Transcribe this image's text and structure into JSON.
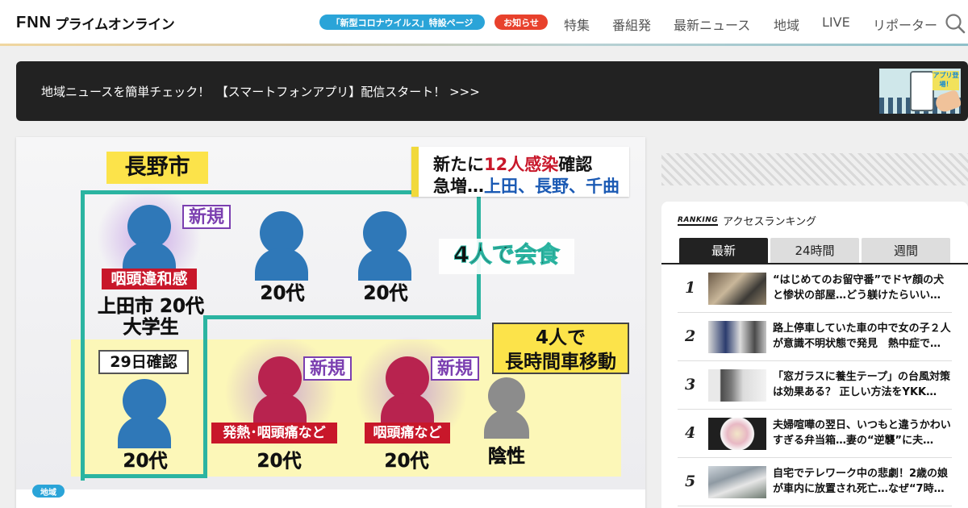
{
  "header": {
    "logo_fnn": "FNN",
    "logo_jp": "プライムオンライン",
    "covid_pill": "「新型コロナウイルス」特設ページ",
    "notice_pill": "お知らせ",
    "nav": [
      "特集",
      "番組発",
      "最新ニュース",
      "地域",
      "LIVE",
      "リポーター"
    ]
  },
  "banner": {
    "text": "地域ニュースを簡単チェック！　【スマートフォンアプリ】配信スタート！ >>>",
    "thumb_badge": "アプリ登場！"
  },
  "hero": {
    "city": "長野市",
    "headline_prefix": "新たに",
    "headline_highlight": "12人感染",
    "headline_suffix": "確認",
    "headline_line2_prefix": "急増…",
    "headline_line2_highlight": "上田、長野、千曲",
    "meal_label": "4人で会食",
    "car_label_1": "4人で",
    "car_label_2": "長時間車移動",
    "new_label": "新規",
    "symptom_throat": "咽頭違和感",
    "person1_line1": "上田市 20代",
    "person1_line2": "大学生",
    "age_20s": "20代",
    "confirmed_29": "29日確認",
    "symptom_fever": "発熱･咽頭痛など",
    "symptom_pain": "咽頭痛など",
    "negative": "陰性",
    "colors": {
      "teal": "#2bb4a1",
      "yellow": "#fce34a",
      "blue": "#2f78b8",
      "magenta": "#b8234f",
      "red": "#c8172a"
    }
  },
  "article": {
    "category": "地域"
  },
  "ranking": {
    "title_en": "RANKING",
    "title_jp": "アクセスランキング",
    "tabs": [
      "最新",
      "24時間",
      "週間"
    ],
    "active_tab": "最新",
    "items": [
      {
        "rank": "1",
        "title": "“はじめてのお留守番”でドヤ顔の犬と惨状の部屋…どう躾けたらいい…"
      },
      {
        "rank": "2",
        "title": "路上停車していた車の中で女の子２人が意識不明状態で発見　熱中症で…"
      },
      {
        "rank": "3",
        "title": "「窓ガラスに養生テープ」の台風対策は効果ある？ 正しい方法をYKK…"
      },
      {
        "rank": "4",
        "title": "夫婦喧嘩の翌日、いつもと違うかわいすぎる弁当箱…妻の“逆襲”に夫…"
      },
      {
        "rank": "5",
        "title": "自宅でテレワーク中の悲劇！2歳の娘が車内に放置され死亡…なぜ“7時…"
      }
    ]
  }
}
